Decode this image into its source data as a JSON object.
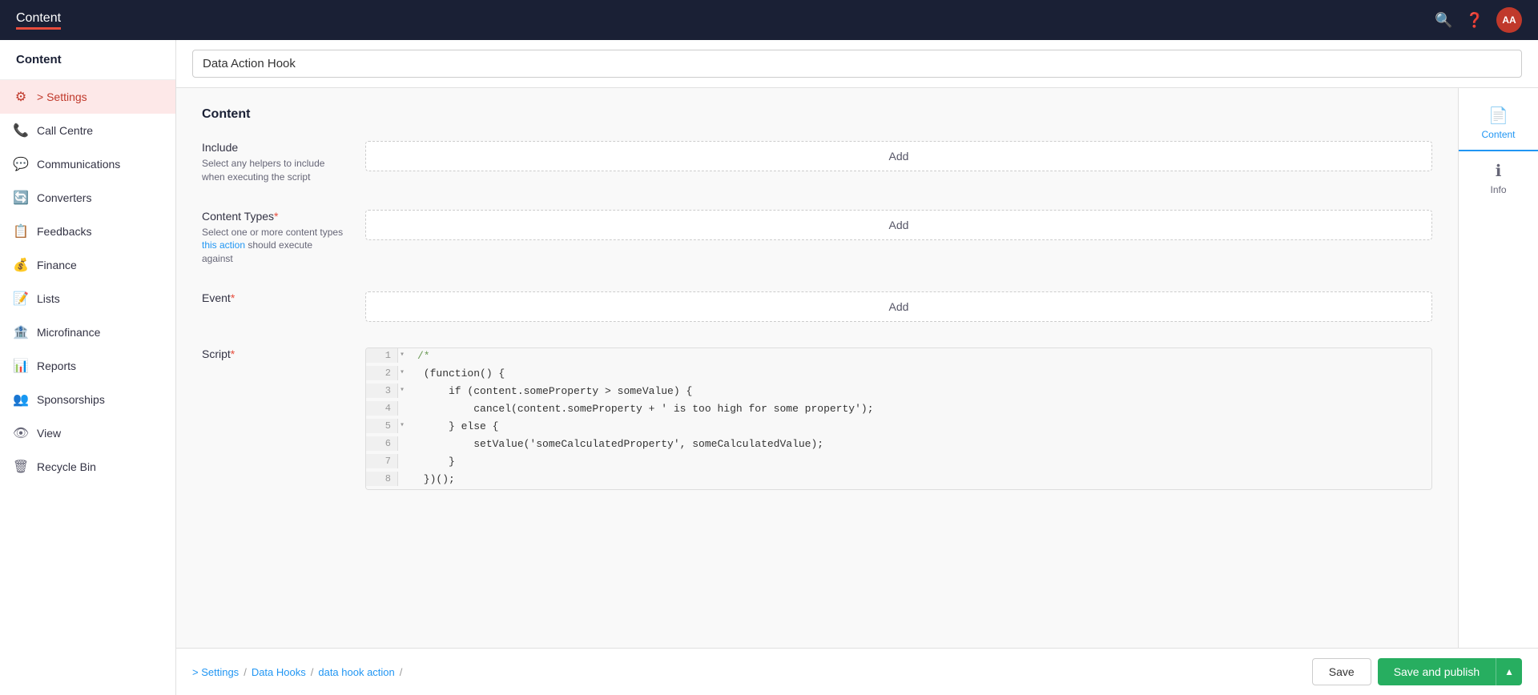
{
  "app": {
    "title": "Content"
  },
  "topnav": {
    "title": "Content",
    "search_icon": "🔍",
    "help_icon": "❓",
    "avatar_text": "AA"
  },
  "sidebar": {
    "header": "Content",
    "items": [
      {
        "id": "settings",
        "label": "> Settings",
        "active": true,
        "icon": "⚙"
      },
      {
        "id": "call-centre",
        "label": "Call Centre",
        "active": false,
        "icon": "📞"
      },
      {
        "id": "communications",
        "label": "Communications",
        "active": false,
        "icon": "💬"
      },
      {
        "id": "converters",
        "label": "Converters",
        "active": false,
        "icon": "🔄"
      },
      {
        "id": "feedbacks",
        "label": "Feedbacks",
        "active": false,
        "icon": "📋"
      },
      {
        "id": "finance",
        "label": "Finance",
        "active": false,
        "icon": "💰"
      },
      {
        "id": "lists",
        "label": "Lists",
        "active": false,
        "icon": "📝"
      },
      {
        "id": "microfinance",
        "label": "Microfinance",
        "active": false,
        "icon": "🏦"
      },
      {
        "id": "reports",
        "label": "Reports",
        "active": false,
        "icon": "📊"
      },
      {
        "id": "sponsorships",
        "label": "Sponsorships",
        "active": false,
        "icon": "👥"
      },
      {
        "id": "view",
        "label": "View",
        "active": false,
        "icon": "👁"
      },
      {
        "id": "recycle-bin",
        "label": "Recycle Bin",
        "active": false,
        "icon": "🗑"
      }
    ]
  },
  "title_bar": {
    "value": "Data Action Hook"
  },
  "right_tabs": [
    {
      "id": "content",
      "label": "Content",
      "icon": "📄",
      "active": true
    },
    {
      "id": "info",
      "label": "Info",
      "icon": "ℹ",
      "active": false
    }
  ],
  "form": {
    "section_title": "Content",
    "fields": [
      {
        "id": "include",
        "label": "Include",
        "required": false,
        "help": "Select any helpers to include when executing the script",
        "help_link": null,
        "add_label": "Add"
      },
      {
        "id": "content-types",
        "label": "Content Types",
        "required": true,
        "help": "Select one or more content types this action should execute against",
        "help_link": "this action",
        "add_label": "Add"
      },
      {
        "id": "event",
        "label": "Event",
        "required": true,
        "help": "",
        "help_link": null,
        "add_label": "Add"
      },
      {
        "id": "script",
        "label": "Script",
        "required": true,
        "help": "",
        "help_link": null,
        "add_label": null
      }
    ],
    "code_lines": [
      {
        "num": "1",
        "collapse": "▾",
        "code": "/*",
        "class": "code-comment"
      },
      {
        "num": "2",
        "collapse": "▾",
        "code": " (function() {",
        "class": ""
      },
      {
        "num": "3",
        "collapse": "▾",
        "code": "     if (content.someProperty > someValue) {",
        "class": ""
      },
      {
        "num": "4",
        "collapse": "",
        "code": "         cancel(content.someProperty + ' is too high for some property');",
        "class": ""
      },
      {
        "num": "5",
        "collapse": "▾",
        "code": "     } else {",
        "class": ""
      },
      {
        "num": "6",
        "collapse": "",
        "code": "         setValue('someCalculatedProperty', someCalculatedValue);",
        "class": ""
      },
      {
        "num": "7",
        "collapse": "",
        "code": "     }",
        "class": ""
      },
      {
        "num": "8",
        "collapse": "",
        "code": " })();",
        "class": ""
      }
    ]
  },
  "footer": {
    "breadcrumb": [
      {
        "text": "> Settings",
        "link": true
      },
      {
        "separator": "/"
      },
      {
        "text": "Data Hooks",
        "link": true
      },
      {
        "separator": "/"
      },
      {
        "text": "data hook action",
        "link": true
      },
      {
        "separator": "/"
      }
    ],
    "save_label": "Save",
    "publish_label": "Save and publish",
    "publish_arrow": "▲"
  }
}
